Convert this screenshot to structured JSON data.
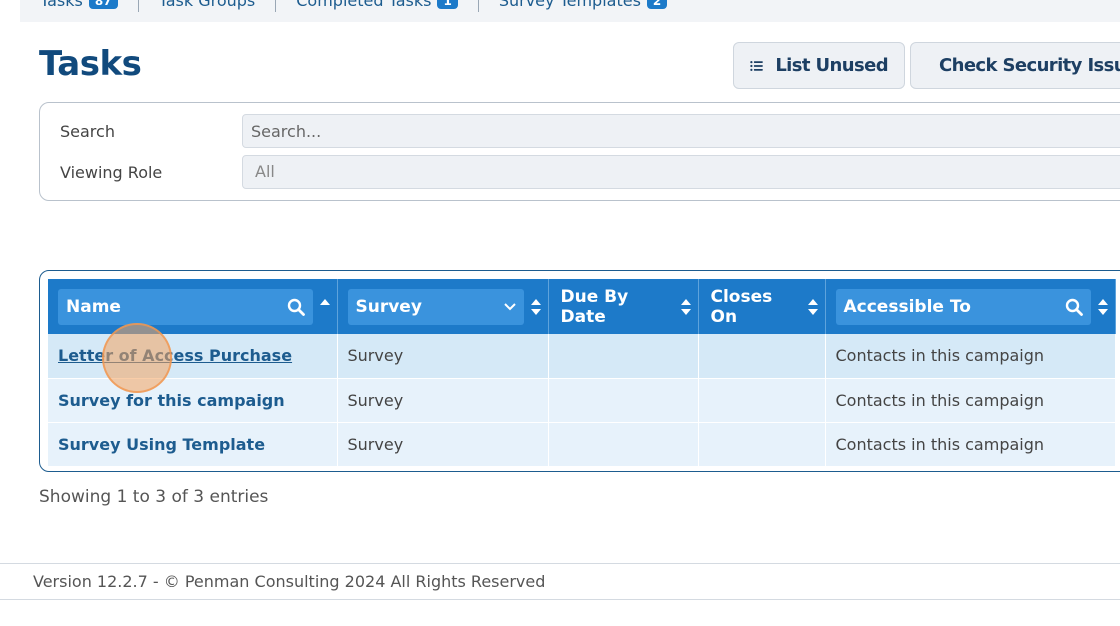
{
  "tabs": [
    {
      "label": "Tasks",
      "badge": "87"
    },
    {
      "label": "Task Groups",
      "badge": ""
    },
    {
      "label": "Completed Tasks",
      "badge": "1"
    },
    {
      "label": "Survey Templates",
      "badge": "2"
    }
  ],
  "page": {
    "title": "Tasks"
  },
  "actions": {
    "list_unused": "List Unused",
    "check_security": "Check Security Issue"
  },
  "filters": {
    "search_label": "Search",
    "search_placeholder": "Search...",
    "role_label": "Viewing Role",
    "role_value": "All"
  },
  "table": {
    "columns": {
      "name": "Name",
      "survey": "Survey",
      "due": "Due By Date",
      "closes": "Closes On",
      "accessible": "Accessible To"
    },
    "rows": [
      {
        "name": "Letter of Access Purchase",
        "survey": "Survey",
        "due": "",
        "closes": "",
        "accessible": "Contacts in this campaign"
      },
      {
        "name": "Survey for this campaign",
        "survey": "Survey",
        "due": "",
        "closes": "",
        "accessible": "Contacts in this campaign"
      },
      {
        "name": "Survey Using Template",
        "survey": "Survey",
        "due": "",
        "closes": "",
        "accessible": "Contacts in this campaign"
      }
    ]
  },
  "entries": "Showing 1 to 3 of 3 entries",
  "footer": "Version 12.2.7 - © Penman Consulting 2024 All Rights Reserved",
  "colors": {
    "accent": "#1d7ac9",
    "title": "#114a7d"
  }
}
